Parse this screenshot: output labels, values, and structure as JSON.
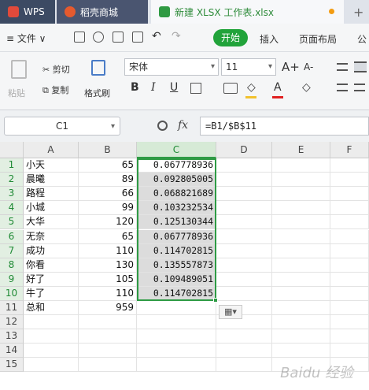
{
  "tabs": {
    "wps": "WPS",
    "daoke": "稻壳商城",
    "active": "新建 XLSX 工作表.xlsx",
    "add": "+"
  },
  "menu": {
    "file": "≡ 文件 ∨",
    "start": "开始",
    "insert": "插入",
    "layout": "页面布局",
    "formula_partial": "公"
  },
  "ribbon": {
    "paste": "粘贴",
    "cut": "剪切",
    "copy": "复制",
    "format_painter": "格式刷",
    "font_name": "宋体",
    "font_size": "11",
    "bold": "B",
    "italic": "I",
    "underline": "U",
    "grow": "A+",
    "shrink": "A-"
  },
  "formula_bar": {
    "name_box": "C1",
    "fx": "fx",
    "formula": "=B1/$B$11"
  },
  "columns": [
    "A",
    "B",
    "C",
    "D",
    "E",
    "F"
  ],
  "rows": [
    "1",
    "2",
    "3",
    "4",
    "5",
    "6",
    "7",
    "8",
    "9",
    "10",
    "11",
    "12",
    "13",
    "14",
    "15"
  ],
  "data": [
    {
      "name": "小天",
      "value": "65",
      "ratio": "0.067778936"
    },
    {
      "name": "晨曦",
      "value": "89",
      "ratio": "0.092805005"
    },
    {
      "name": "路程",
      "value": "66",
      "ratio": "0.068821689"
    },
    {
      "name": "小城",
      "value": "99",
      "ratio": "0.103232534"
    },
    {
      "name": "大华",
      "value": "120",
      "ratio": "0.125130344"
    },
    {
      "name": "无奈",
      "value": "65",
      "ratio": "0.067778936"
    },
    {
      "name": "成功",
      "value": "110",
      "ratio": "0.114702815"
    },
    {
      "name": "你看",
      "value": "130",
      "ratio": "0.135557873"
    },
    {
      "name": "好了",
      "value": "105",
      "ratio": "0.109489051"
    },
    {
      "name": "牛了",
      "value": "110",
      "ratio": "0.114702815"
    }
  ],
  "total": {
    "name": "总和",
    "value": "959"
  },
  "watermark": "Baidu 经验"
}
